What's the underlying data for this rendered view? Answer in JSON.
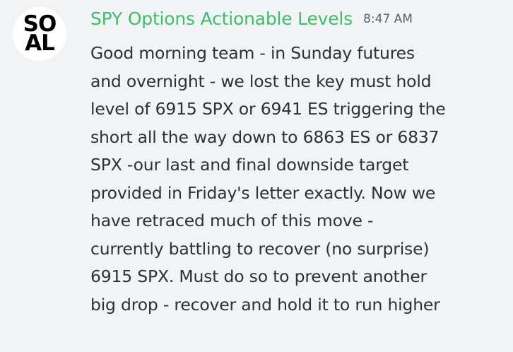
{
  "message": {
    "avatar": {
      "line1": "SO",
      "line2": "AL"
    },
    "author": "SPY Options Actionable Levels",
    "timestamp": "8:47 AM",
    "lines": [
      "Good morning team - in Sunday futures",
      "and overnight - we lost the key must hold",
      "level of 6915 SPX or 6941 ES triggering the",
      "short all the way down to 6863 ES or 6837",
      "SPX -our last and final downside target",
      "provided in Friday's letter exactly. Now we",
      "have retraced much of this move -",
      "currently battling to recover (no surprise)",
      "6915 SPX. Must do so to prevent another",
      "big drop - recover and hold it to run higher"
    ]
  },
  "colors": {
    "background": "#f2f3f5",
    "author": "#3fbd6a",
    "timestamp": "#5c5e66",
    "text": "#2e3035"
  }
}
